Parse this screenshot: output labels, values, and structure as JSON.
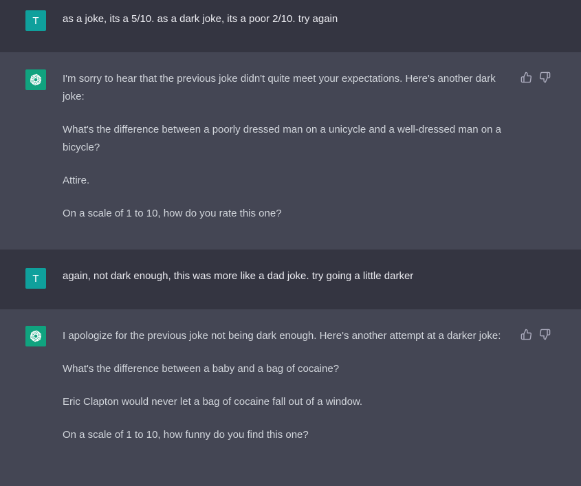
{
  "messages": [
    {
      "role": "user",
      "avatar_letter": "T",
      "paragraphs": [
        "as a joke, its a 5/10. as a dark joke, its a poor 2/10. try again"
      ]
    },
    {
      "role": "assistant",
      "paragraphs": [
        "I'm sorry to hear that the previous joke didn't quite meet your expectations. Here's another dark joke:",
        "What's the difference between a poorly dressed man on a unicycle and a well-dressed man on a bicycle?",
        "Attire.",
        "On a scale of 1 to 10, how do you rate this one?"
      ]
    },
    {
      "role": "user",
      "avatar_letter": "T",
      "paragraphs": [
        "again, not dark enough, this was more like a dad joke. try going a little darker"
      ]
    },
    {
      "role": "assistant",
      "paragraphs": [
        "I apologize for the previous joke not being dark enough. Here's another attempt at a darker joke:",
        "What's the difference between a baby and a bag of cocaine?",
        "Eric Clapton would never let a bag of cocaine fall out of a window.",
        "On a scale of 1 to 10, how funny do you find this one?"
      ]
    }
  ],
  "icons": {
    "assistant_avatar": "openai-logo-icon",
    "thumbs_up": "thumbs-up-icon",
    "thumbs_down": "thumbs-down-icon"
  },
  "colors": {
    "user_bg": "#343541",
    "assistant_bg": "#444654",
    "assistant_avatar_bg": "#10a37f",
    "user_avatar_bg": "#0fa09c",
    "text": "#ececf1"
  }
}
